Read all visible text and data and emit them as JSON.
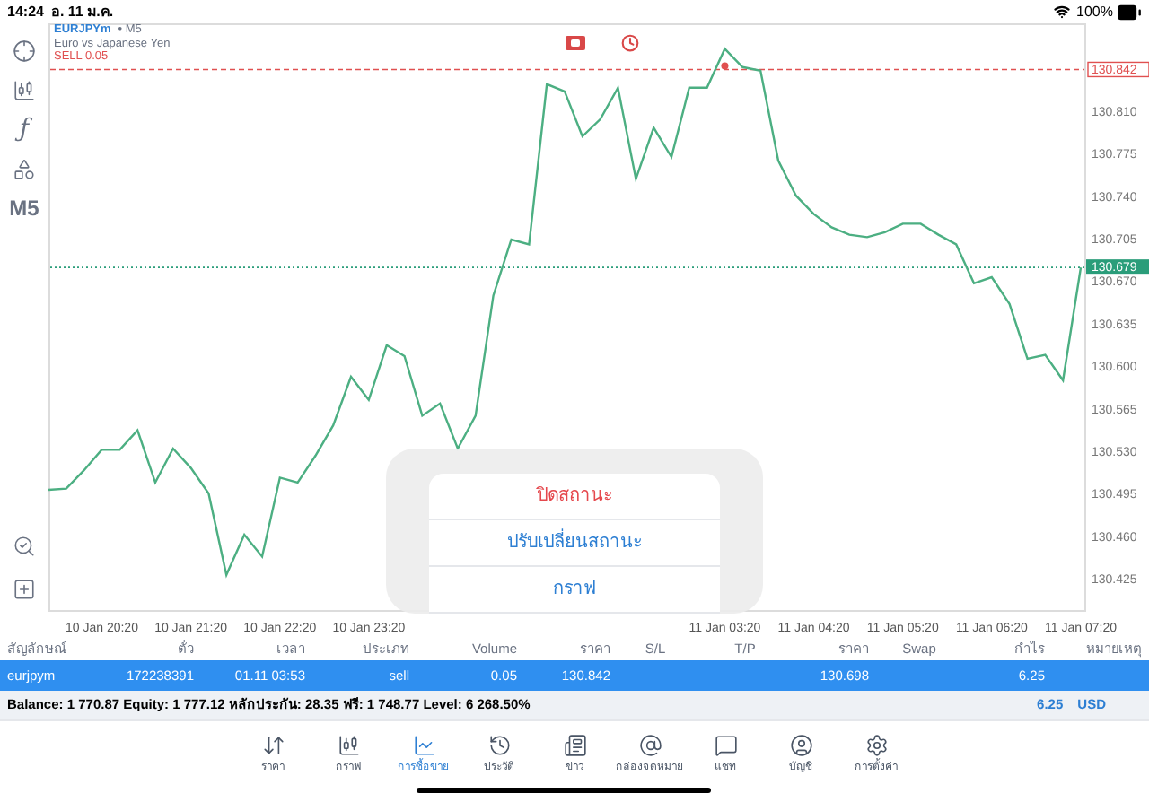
{
  "status_bar": {
    "time": "14:24",
    "date": "อ. 11 ม.ค.",
    "battery": "100%"
  },
  "toolbar": {
    "items": [
      {
        "kind": "crosshair"
      },
      {
        "kind": "candles"
      },
      {
        "kind": "glyph",
        "text": "ƒ"
      },
      {
        "kind": "shapes"
      },
      {
        "kind": "glyph",
        "text": "M5"
      }
    ],
    "bottom": [
      {
        "kind": "zoom"
      },
      {
        "kind": "add"
      }
    ]
  },
  "chart_header": {
    "symbol": "EURJPYm",
    "timeframe": "• M5",
    "description": "Euro vs Japanese Yen",
    "position": "SELL 0.05"
  },
  "chart": {
    "chart_data": {
      "type": "line",
      "categories": [
        null,
        null,
        null,
        "10 Jan 20:20",
        null,
        null,
        null,
        null,
        "10 Jan 21:20",
        null,
        null,
        null,
        null,
        "10 Jan 22:20",
        null,
        null,
        null,
        null,
        "10 Jan 23:20",
        null,
        null,
        null,
        null,
        null,
        null,
        null,
        null,
        null,
        null,
        null,
        null,
        null,
        null,
        null,
        null,
        null,
        null,
        null,
        "11 Jan 03:20",
        null,
        null,
        null,
        null,
        "11 Jan 04:20",
        null,
        null,
        null,
        null,
        "11 Jan 05:20",
        null,
        null,
        null,
        null,
        "11 Jan 06:20",
        null,
        null,
        null,
        null,
        "11 Jan 07:20"
      ],
      "series": [
        {
          "color": "#4caf82",
          "values": [
            130.496,
            130.497,
            130.512,
            130.529,
            130.529,
            130.545,
            130.502,
            130.53,
            130.514,
            130.493,
            130.426,
            130.459,
            130.441,
            130.506,
            130.502,
            130.524,
            130.549,
            130.589,
            130.57,
            130.615,
            130.606,
            130.557,
            130.567,
            130.53,
            130.557,
            130.656,
            130.702,
            130.698,
            130.83,
            130.824,
            130.787,
            130.801,
            130.827,
            130.752,
            130.794,
            130.77,
            130.827,
            130.827,
            130.859,
            130.844,
            130.841,
            130.767,
            130.738,
            130.723,
            130.712,
            130.706,
            130.704,
            130.708,
            130.715,
            130.715,
            130.706,
            130.698,
            130.666,
            130.671,
            130.649,
            130.604,
            130.607,
            130.586,
            130.679
          ]
        }
      ],
      "ylim": [
        130.397,
        130.88
      ],
      "yticks": [
        {
          "value": 130.81,
          "label": "130.810"
        },
        {
          "value": 130.775,
          "label": "130.775"
        },
        {
          "value": 130.74,
          "label": "130.740"
        },
        {
          "value": 130.705,
          "label": "130.705"
        },
        {
          "value": 130.67,
          "label": "130.670"
        },
        {
          "value": 130.635,
          "label": "130.635"
        },
        {
          "value": 130.6,
          "label": "130.600"
        },
        {
          "value": 130.565,
          "label": "130.565"
        },
        {
          "value": 130.53,
          "label": "130.530"
        },
        {
          "value": 130.495,
          "label": "130.495"
        },
        {
          "value": 130.46,
          "label": "130.460"
        },
        {
          "value": 130.425,
          "label": "130.425"
        }
      ],
      "ref_lines": [
        {
          "axis": "y",
          "value": 130.842,
          "label": "130.842",
          "color": "#e05050"
        },
        {
          "axis": "y",
          "value": 130.679,
          "label": "130.679",
          "color": "#2a9d7a"
        }
      ]
    }
  },
  "position_menu": {
    "items": [
      {
        "label": "ปิดสถานะ",
        "kind": "destructive"
      },
      {
        "label": "ปรับเปลี่ยนสถานะ",
        "kind": "default"
      },
      {
        "label": "กราฟ",
        "kind": "default"
      }
    ]
  },
  "table": {
    "columns": [
      "สัญลักษณ์",
      "ตั๋ว",
      "เวลา",
      "ประเภท",
      "Volume",
      "ราคา",
      "S/L",
      "T/P",
      "ราคา",
      "Swap",
      "กำไร",
      "หมายเหตุ"
    ],
    "rows": [
      {
        "selected": true,
        "symbol": "eurjpym",
        "ticket": "172238391",
        "time": "01.11 03:53",
        "type": "sell",
        "volume": "0.05",
        "open_price": "130.842",
        "current_price": "130.698",
        "profit": "6.25"
      }
    ],
    "summary": {
      "text": "Balance: 1 770.87 Equity: 1 777.12 หลักประกัน: 28.35 ฟรี: 1 748.77 Level: 6 268.50%",
      "profit": "6.25",
      "currency": "USD"
    }
  },
  "tab_bar": [
    {
      "label": "ราคา",
      "kind": "quotes",
      "selected": false
    },
    {
      "label": "กราฟ",
      "kind": "chart",
      "selected": false
    },
    {
      "label": "การซื้อขาย",
      "kind": "trade",
      "selected": true
    },
    {
      "label": "ประวัติ",
      "kind": "history",
      "selected": false
    },
    {
      "label": "ข่าว",
      "kind": "news",
      "selected": false
    },
    {
      "label": "กล่องจดหมาย",
      "kind": "mail",
      "selected": false
    },
    {
      "label": "แชท",
      "kind": "chat",
      "selected": false
    },
    {
      "label": "บัญชี",
      "kind": "account",
      "selected": false
    },
    {
      "label": "การตั้งค่า",
      "kind": "settings",
      "selected": false
    }
  ]
}
